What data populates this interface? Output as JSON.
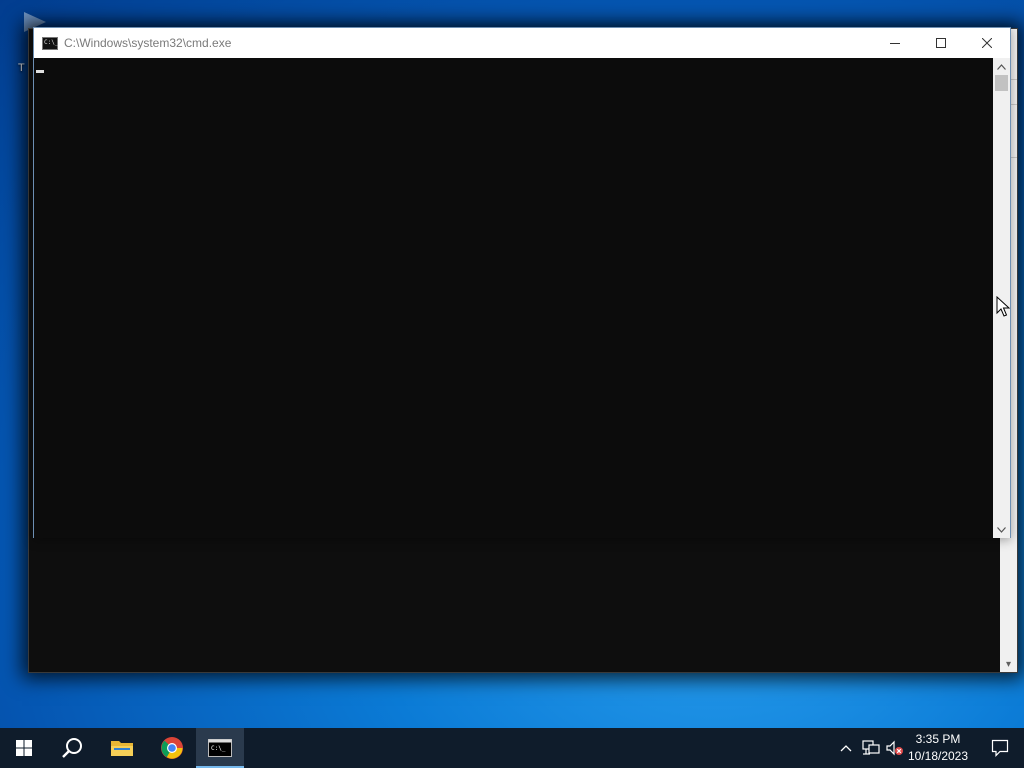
{
  "desktop": {
    "icon_label": "T"
  },
  "window": {
    "title": "C:\\Windows\\system32\\cmd.exe",
    "minimize_label": "Minimize",
    "maximize_label": "Maximize",
    "close_label": "Close"
  },
  "console": {
    "content": ""
  },
  "taskbar": {
    "items": [
      "start-icon",
      "search-icon",
      "file-explorer-icon",
      "chrome-icon",
      "cmd-icon"
    ],
    "time": "3:35 PM",
    "date": "10/18/2023"
  },
  "colors": {
    "console_bg": "#0c0c0c",
    "taskbar_bg": "#0f1c2b",
    "accent": "#76b9ed"
  }
}
